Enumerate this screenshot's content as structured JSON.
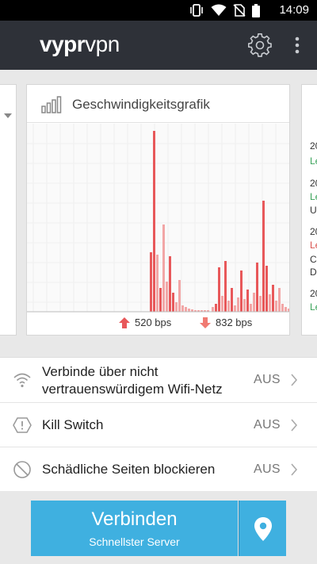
{
  "status_bar": {
    "time": "14:09"
  },
  "app_bar": {
    "logo_bold": "vypr",
    "logo_light": "vpn"
  },
  "speed_card": {
    "title": "Geschwindigkeitsgrafik",
    "upload": "520 bps",
    "download": "832 bps"
  },
  "log_card": {
    "lines": [
      "20",
      "Le",
      "20",
      "Le",
      "U",
      "20",
      "Le",
      "C",
      "D",
      "20",
      "Le"
    ]
  },
  "settings": [
    {
      "label_line1": "Verbinde über nicht",
      "label_line2": "vertrauenswürdigem Wifi-Netz",
      "value": "AUS"
    },
    {
      "label": "Kill Switch",
      "value": "AUS"
    },
    {
      "label": "Schädliche Seiten blockieren",
      "value": "AUS"
    }
  ],
  "connect": {
    "label": "Verbinden",
    "sublabel": "Schnellster Server"
  },
  "colors": {
    "accent": "#3fb0e0",
    "appbar": "#2e3138",
    "bar": "#e8585a",
    "bar_light": "#f2a6a6"
  }
}
